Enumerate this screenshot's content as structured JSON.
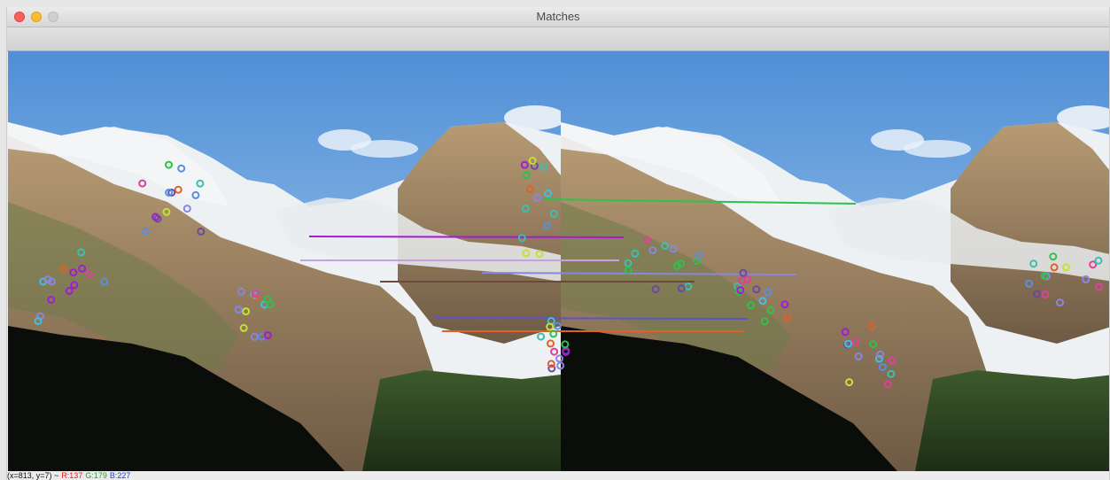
{
  "window": {
    "title": "Matches",
    "controls": [
      "close",
      "minimize",
      "maximize"
    ]
  },
  "status_bar": {
    "coords": "(x=813, y=7) ~",
    "r": "R:137",
    "g": "G:179",
    "b": "B:227"
  },
  "image": {
    "description_colors": {
      "sky_top": "#4f8fd6",
      "sky_bottom": "#a9cdef",
      "rock": "#a08460",
      "snow": "#eef1f4",
      "forest": "#27401f"
    }
  }
}
